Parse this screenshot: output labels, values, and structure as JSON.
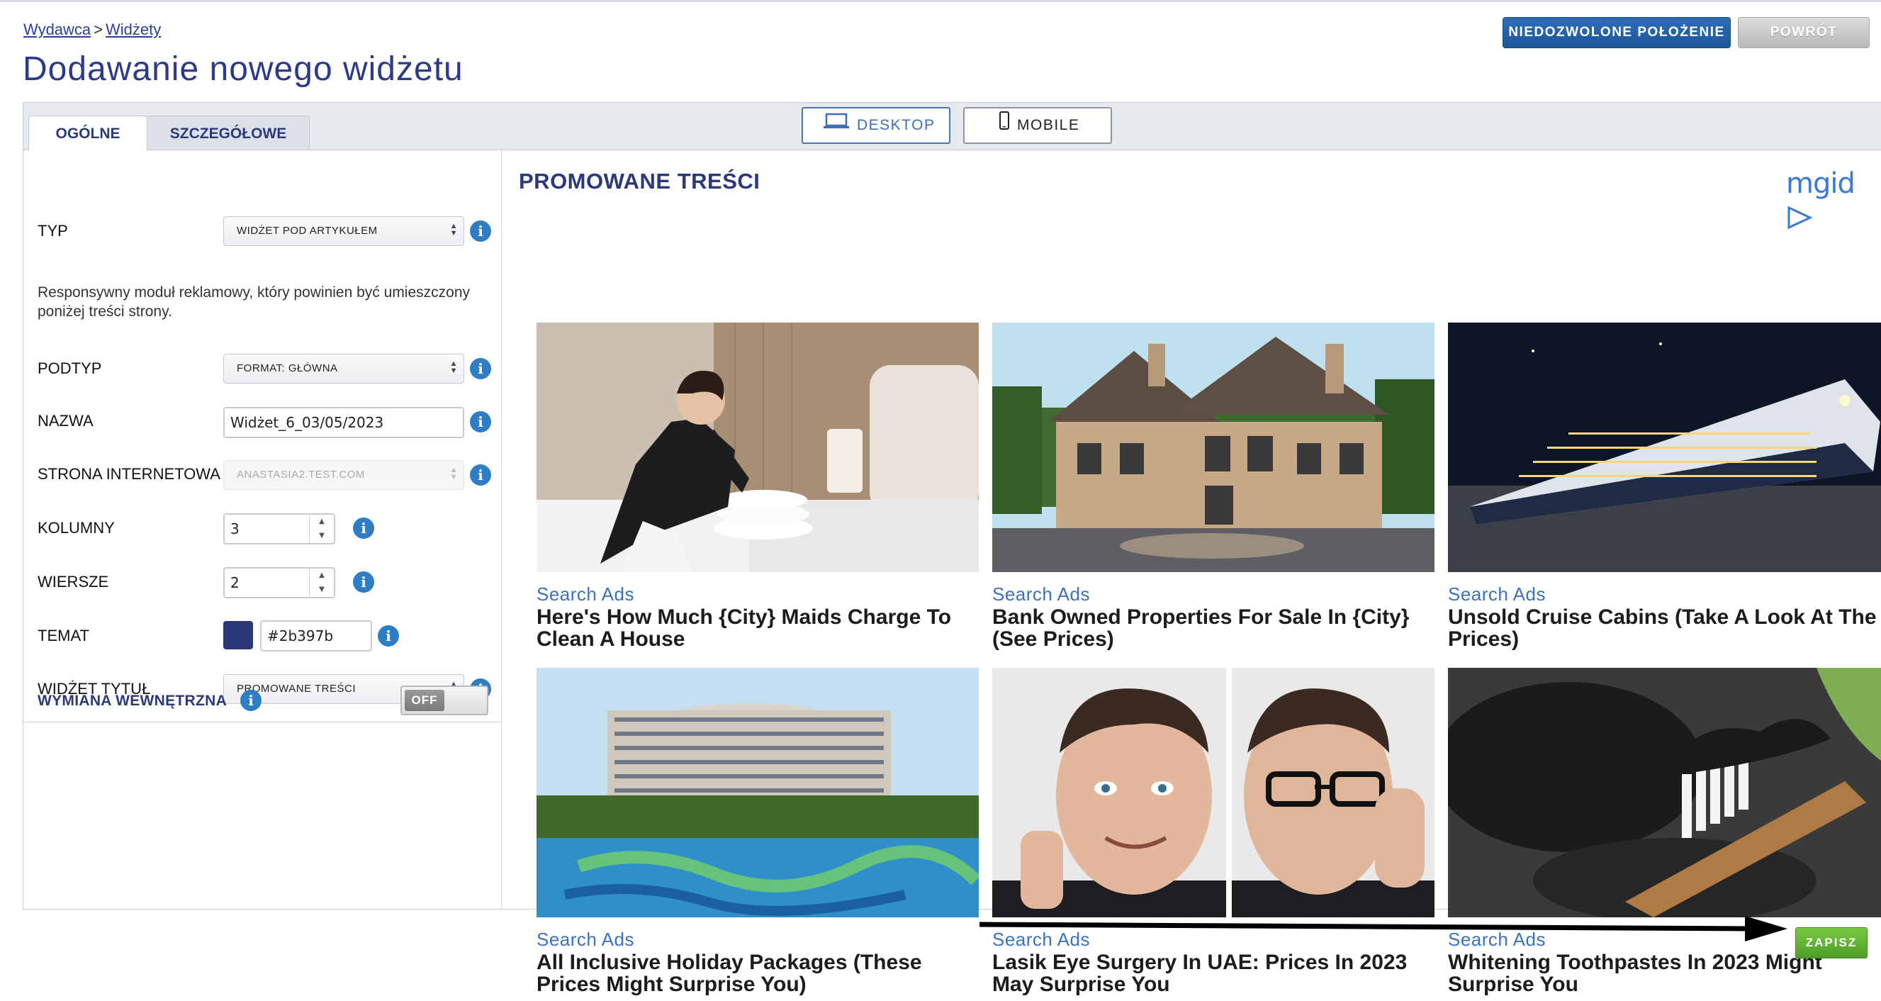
{
  "breadcrumb": {
    "publisher": "Wydawca",
    "separator": ">",
    "widgets": "Widżety"
  },
  "page_title": "Dodawanie nowego widżetu",
  "top_buttons": {
    "invalid_placement": "NIEDOZWOLONE POŁOŻENIE",
    "back": "POWRÓT"
  },
  "tabs": {
    "general": "OGÓLNE",
    "details": "SZCZEGÓŁOWE"
  },
  "view_toggle": {
    "desktop": "DESKTOP",
    "mobile": "MOBILE",
    "selected": "DESKTOP"
  },
  "settings": {
    "type_label": "TYP",
    "type_value": "WIDŻET POD ARTYKUŁEM",
    "description": "Responsywny moduł reklamowy, który powinien być umieszczony poniżej treści strony.",
    "subtype_label": "PODTYP",
    "subtype_value": "FORMAT: GŁÓWNA",
    "name_label": "NAZWA",
    "name_value": "Widżet_6_03/05/2023",
    "website_label": "STRONA INTERNETOWA",
    "website_value": "ANASTASIA2.TEST.COM",
    "columns_label": "KOLUMNY",
    "columns_value": "3",
    "rows_label": "WIERSZE",
    "rows_value": "2",
    "theme_label": "TEMAT",
    "theme_value": "#2b397b",
    "theme_color": "#2b397b",
    "widget_title_label": "WIDŻET TYTUŁ",
    "widget_title_value": "PROMOWANE TREŚCI",
    "internal_exchange_label": "WYMIANA WEWNĘTRZNA",
    "internal_exchange_state": "OFF"
  },
  "preview": {
    "title": "PROMOWANE TREŚCI",
    "logo_text": "mgid",
    "cards": [
      {
        "source": "Search Ads",
        "title": "Here's How Much {City} Maids Charge To Clean A House",
        "image": "maid-folding-towels"
      },
      {
        "source": "Search Ads",
        "title": "Bank Owned Properties For Sale In {City} (See Prices)",
        "image": "large-brick-house"
      },
      {
        "source": "Search Ads",
        "title": "Unsold Cruise Cabins (Take A Look At The Prices)",
        "image": "cruise-ship-at-night"
      },
      {
        "source": "Search Ads",
        "title": "All Inclusive Holiday Packages (These Prices Might Surprise You)",
        "image": "resort-hotel-pool"
      },
      {
        "source": "Search Ads",
        "title": "Lasik Eye Surgery In UAE: Prices In 2023 May Surprise You",
        "image": "man-with-and-without-glasses"
      },
      {
        "source": "Search Ads",
        "title": "Whitening Toothpastes In 2023 Might Surprise You",
        "image": "charcoal-toothpaste-brush"
      }
    ]
  },
  "save_button": "ZAPISZ",
  "colors": {
    "brand_blue": "#2b397b",
    "link_blue": "#3a72c0",
    "save_green": "#5fae33",
    "info_blue": "#2f7dc4"
  }
}
